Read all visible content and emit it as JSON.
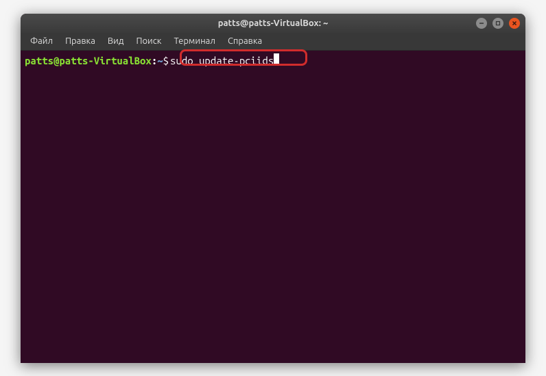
{
  "titlebar": {
    "title": "patts@patts-VirtualBox: ~"
  },
  "menu": {
    "file": "Файл",
    "edit": "Правка",
    "view": "Вид",
    "search": "Поиск",
    "terminal": "Терминал",
    "help": "Справка"
  },
  "prompt": {
    "userhost": "patts@patts-VirtualBox",
    "colon": ":",
    "path": "~",
    "symbol": "$"
  },
  "command": "sudo update-pciids",
  "colors": {
    "terminal_bg": "#300a24",
    "prompt_user": "#8ae234",
    "prompt_path": "#729fcf",
    "highlight": "#d12c2c",
    "close_btn": "#e95420"
  }
}
